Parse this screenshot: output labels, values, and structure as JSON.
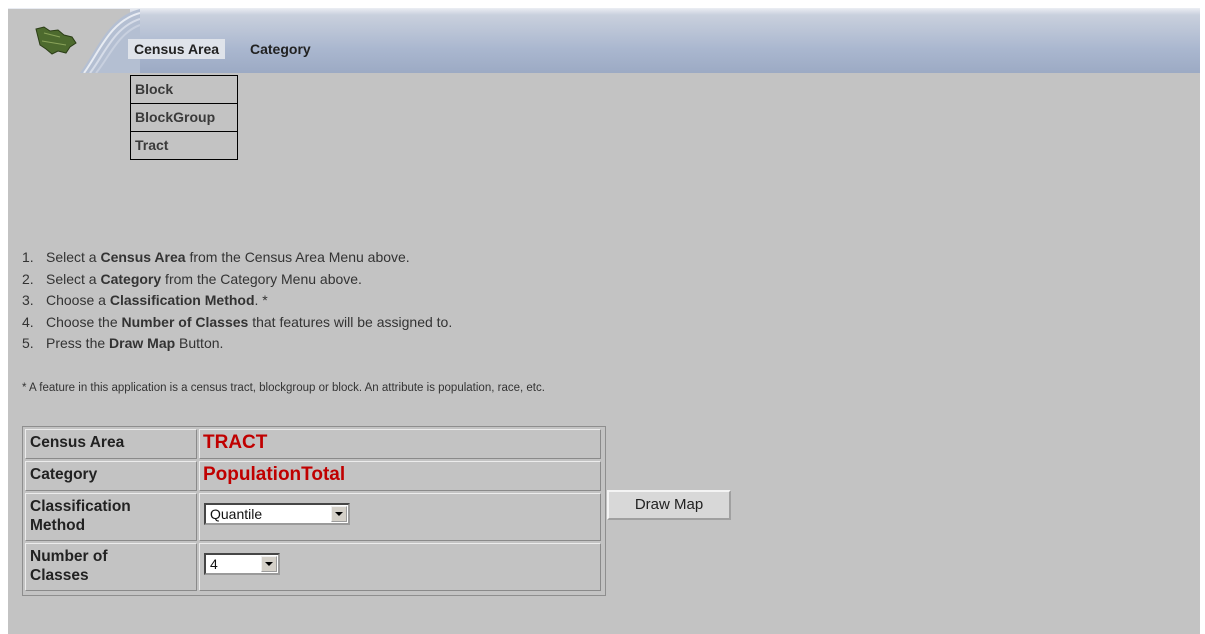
{
  "menubar": {
    "tabs": [
      {
        "label": "Census Area"
      },
      {
        "label": "Category"
      }
    ],
    "logo_icon": "map-region-icon",
    "accent": "#9caac4"
  },
  "census_area_menu": {
    "items": [
      "Block",
      "BlockGroup",
      "Tract"
    ]
  },
  "instructions": {
    "steps": [
      {
        "num": "1.",
        "pre": "Select a ",
        "bold": "Census Area",
        "post": " from the Census Area Menu above."
      },
      {
        "num": "2.",
        "pre": "Select a ",
        "bold": "Category",
        "post": " from the Category Menu above."
      },
      {
        "num": "3.",
        "pre": "Choose a ",
        "bold": "Classification Method",
        "post": ". *"
      },
      {
        "num": "4.",
        "pre": "Choose the ",
        "bold": "Number of Classes",
        "post": " that features will be assigned to."
      },
      {
        "num": "5.",
        "pre": "Press the ",
        "bold": "Draw Map",
        "post": " Button."
      }
    ],
    "note": "* A feature in this application is a census tract, blockgroup or block.  An attribute is population, race, etc."
  },
  "form": {
    "census_area": {
      "label": "Census Area",
      "value": "TRACT"
    },
    "category": {
      "label": "Category",
      "value": "PopulationTotal"
    },
    "classification_method": {
      "label_line1": "Classification",
      "label_line2": "Method",
      "selected": "Quantile"
    },
    "number_of_classes": {
      "label_line1": "Number of",
      "label_line2": "Classes",
      "selected": "4"
    },
    "value_color": "#c00000"
  },
  "draw_map_button": {
    "label": "Draw Map"
  }
}
